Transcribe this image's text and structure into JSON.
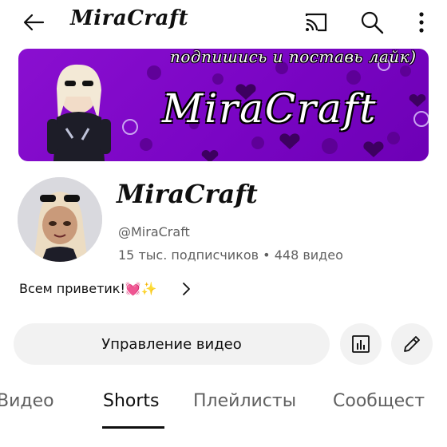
{
  "header": {
    "title": "MiraCraft",
    "back_icon": "arrow-left-icon",
    "cast_icon": "cast-icon",
    "search_icon": "search-icon",
    "more_icon": "more-vertical-icon"
  },
  "banner": {
    "tagline": "подпишись и поставь лайк)",
    "name": "MiraCraft",
    "colors": {
      "background": "#7a05c4",
      "dots": "#5a0090",
      "hearts": "#3d0060",
      "smiley": "#c9a3f0"
    }
  },
  "channel": {
    "name": "MiraCraft",
    "handle": "@MiraCraft",
    "subscribers": "15 тыс. подписчиков",
    "separator": "•",
    "videos": "448 видео",
    "description": "Всем приветик!💓✨"
  },
  "actions": {
    "manage_label": "Управление видео",
    "analytics_icon": "analytics-icon",
    "edit_icon": "pencil-icon"
  },
  "tabs": [
    {
      "label": "Видео",
      "active": false
    },
    {
      "label": "Shorts",
      "active": true
    },
    {
      "label": "Плейлисты",
      "active": false
    },
    {
      "label": "Сообщест",
      "active": false
    }
  ]
}
